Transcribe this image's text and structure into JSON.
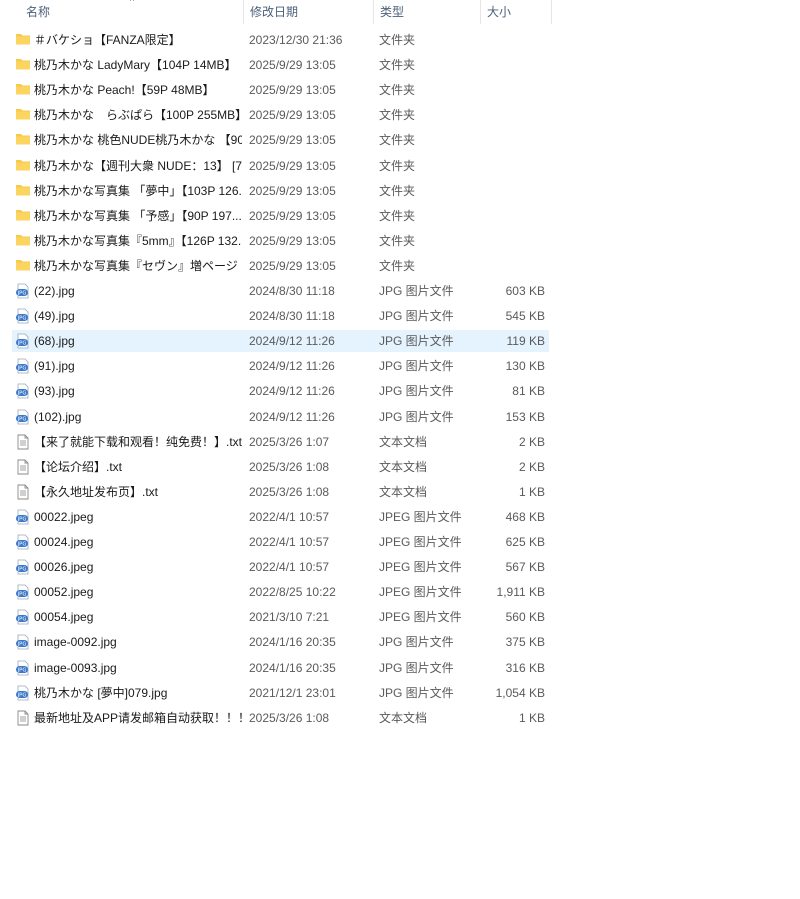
{
  "columns": {
    "name": "名称",
    "date": "修改日期",
    "type": "类型",
    "size": "大小"
  },
  "sort_indicator": "^",
  "files": [
    {
      "icon": "folder-icon",
      "name": "＃バケショ【FANZA限定】",
      "date": "2023/12/30 21:36",
      "type": "文件夹",
      "size": ""
    },
    {
      "icon": "folder-icon",
      "name": "桃乃木かな LadyMary【104P 14MB】",
      "date": "2025/9/29 13:05",
      "type": "文件夹",
      "size": ""
    },
    {
      "icon": "folder-icon",
      "name": "桃乃木かな Peach!【59P 48MB】",
      "date": "2025/9/29 13:05",
      "type": "文件夹",
      "size": ""
    },
    {
      "icon": "folder-icon",
      "name": "桃乃木かな　らぶぱら【100P 255MB】",
      "date": "2025/9/29 13:05",
      "type": "文件夹",
      "size": ""
    },
    {
      "icon": "folder-icon",
      "name": "桃乃木かな 桃色NUDE桃乃木かな 【90...",
      "date": "2025/9/29 13:05",
      "type": "文件夹",
      "size": ""
    },
    {
      "icon": "folder-icon",
      "name": "桃乃木かな【週刊大衆 NUDE：13】 [7...",
      "date": "2025/9/29 13:05",
      "type": "文件夹",
      "size": ""
    },
    {
      "icon": "folder-icon",
      "name": "桃乃木かな写真集 「夢中」【103P 126...",
      "date": "2025/9/29 13:05",
      "type": "文件夹",
      "size": ""
    },
    {
      "icon": "folder-icon",
      "name": "桃乃木かな写真集 「予感」【90P 197...",
      "date": "2025/9/29 13:05",
      "type": "文件夹",
      "size": ""
    },
    {
      "icon": "folder-icon",
      "name": "桃乃木かな写真集『5mm』【126P 132...",
      "date": "2025/9/29 13:05",
      "type": "文件夹",
      "size": ""
    },
    {
      "icon": "folder-icon",
      "name": "桃乃木かな写真集『セヴン』増ページ【...",
      "date": "2025/9/29 13:05",
      "type": "文件夹",
      "size": ""
    },
    {
      "icon": "jpg-file-icon",
      "name": "(22).jpg",
      "date": "2024/8/30 11:18",
      "type": "JPG 图片文件",
      "size": "603 KB"
    },
    {
      "icon": "jpg-file-icon",
      "name": "(49).jpg",
      "date": "2024/8/30 11:18",
      "type": "JPG 图片文件",
      "size": "545 KB"
    },
    {
      "icon": "jpg-file-icon",
      "name": "(68).jpg",
      "date": "2024/9/12 11:26",
      "type": "JPG 图片文件",
      "size": "119 KB",
      "selected": true
    },
    {
      "icon": "jpg-file-icon",
      "name": "(91).jpg",
      "date": "2024/9/12 11:26",
      "type": "JPG 图片文件",
      "size": "130 KB"
    },
    {
      "icon": "jpg-file-icon",
      "name": "(93).jpg",
      "date": "2024/9/12 11:26",
      "type": "JPG 图片文件",
      "size": "81 KB"
    },
    {
      "icon": "jpg-file-icon",
      "name": "(102).jpg",
      "date": "2024/9/12 11:26",
      "type": "JPG 图片文件",
      "size": "153 KB"
    },
    {
      "icon": "text-file-icon",
      "name": "【来了就能下载和观看！纯免费！】.txt",
      "date": "2025/3/26 1:07",
      "type": "文本文档",
      "size": "2 KB"
    },
    {
      "icon": "text-file-icon",
      "name": "【论坛介绍】.txt",
      "date": "2025/3/26 1:08",
      "type": "文本文档",
      "size": "2 KB"
    },
    {
      "icon": "text-file-icon",
      "name": "【永久地址发布页】.txt",
      "date": "2025/3/26 1:08",
      "type": "文本文档",
      "size": "1 KB"
    },
    {
      "icon": "jpg-file-icon",
      "name": "00022.jpeg",
      "date": "2022/4/1 10:57",
      "type": "JPEG 图片文件",
      "size": "468 KB"
    },
    {
      "icon": "jpg-file-icon",
      "name": "00024.jpeg",
      "date": "2022/4/1 10:57",
      "type": "JPEG 图片文件",
      "size": "625 KB"
    },
    {
      "icon": "jpg-file-icon",
      "name": "00026.jpeg",
      "date": "2022/4/1 10:57",
      "type": "JPEG 图片文件",
      "size": "567 KB"
    },
    {
      "icon": "jpg-file-icon",
      "name": "00052.jpeg",
      "date": "2022/8/25 10:22",
      "type": "JPEG 图片文件",
      "size": "1,911 KB"
    },
    {
      "icon": "jpg-file-icon",
      "name": "00054.jpeg",
      "date": "2021/3/10 7:21",
      "type": "JPEG 图片文件",
      "size": "560 KB"
    },
    {
      "icon": "jpg-file-icon",
      "name": "image-0092.jpg",
      "date": "2024/1/16 20:35",
      "type": "JPG 图片文件",
      "size": "375 KB"
    },
    {
      "icon": "jpg-file-icon",
      "name": "image-0093.jpg",
      "date": "2024/1/16 20:35",
      "type": "JPG 图片文件",
      "size": "316 KB"
    },
    {
      "icon": "jpg-file-icon",
      "name": "桃乃木かな [夢中]079.jpg",
      "date": "2021/12/1 23:01",
      "type": "JPG 图片文件",
      "size": "1,054 KB"
    },
    {
      "icon": "text-file-icon",
      "name": "最新地址及APP请发邮箱自动获取！！！....",
      "date": "2025/3/26 1:08",
      "type": "文本文档",
      "size": "1 KB"
    }
  ],
  "colors": {
    "selection": "#e5f3ff",
    "folder": "#f8c94a",
    "jpg_badge": "#3a78c9",
    "header_text": "#4c607a"
  }
}
